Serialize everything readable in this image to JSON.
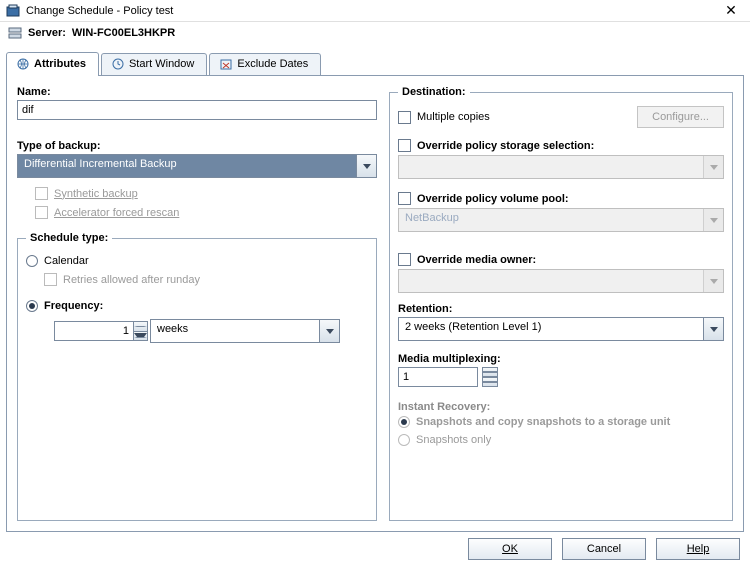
{
  "window": {
    "title": "Change Schedule - Policy test"
  },
  "server": {
    "label": "Server:",
    "name": "WIN-FC00EL3HKPR"
  },
  "tabs": {
    "attributes": "Attributes",
    "start_window": "Start Window",
    "exclude_dates": "Exclude Dates"
  },
  "left": {
    "name_label": "Name:",
    "name_value": "dif",
    "type_label": "Type of backup:",
    "type_value": "Differential Incremental Backup",
    "synthetic": "Synthetic backup",
    "accelerator": "Accelerator forced rescan",
    "schedule_legend": "Schedule type:",
    "calendar": "Calendar",
    "retries": "Retries allowed after runday",
    "frequency": "Frequency:",
    "freq_value": "1",
    "freq_unit": "weeks"
  },
  "right": {
    "legend": "Destination:",
    "multiple_copies": "Multiple copies",
    "configure": "Configure...",
    "override_storage": "Override policy storage selection:",
    "storage_value": "",
    "override_pool": "Override policy volume pool:",
    "pool_value": "NetBackup",
    "override_owner": "Override media owner:",
    "owner_value": "",
    "retention_label": "Retention:",
    "retention_value": "2 weeks (Retention Level 1)",
    "mm_label": "Media multiplexing:",
    "mm_value": "1",
    "instant_legend": "Instant Recovery:",
    "ir_copy": "Snapshots and copy snapshots to a storage unit",
    "ir_only": "Snapshots only"
  },
  "footer": {
    "ok": "OK",
    "cancel": "Cancel",
    "help": "Help"
  }
}
